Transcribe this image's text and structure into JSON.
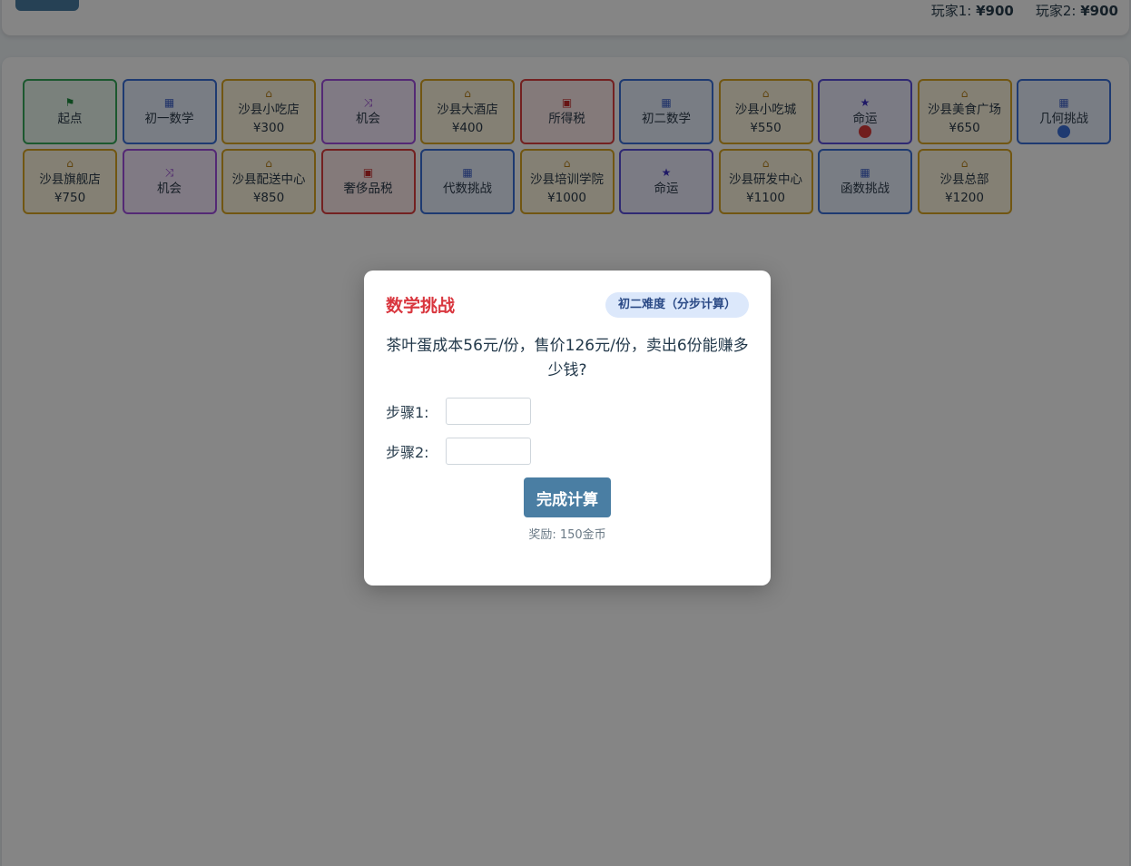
{
  "header": {
    "players": [
      {
        "label": "玩家1:",
        "money": "¥900"
      },
      {
        "label": "玩家2:",
        "money": "¥900"
      }
    ]
  },
  "board": {
    "cells": [
      {
        "type": "start",
        "icon": "flag-icon",
        "glyph": "⚑",
        "name": "起点",
        "price": ""
      },
      {
        "type": "math",
        "icon": "calculator-icon",
        "glyph": "▦",
        "name": "初一数学",
        "price": ""
      },
      {
        "type": "property",
        "icon": "house-icon",
        "glyph": "⌂",
        "name": "沙县小吃店",
        "price": "¥300"
      },
      {
        "type": "chance",
        "icon": "shuffle-icon",
        "glyph": "⤨",
        "name": "机会",
        "price": ""
      },
      {
        "type": "property",
        "icon": "house-icon",
        "glyph": "⌂",
        "name": "沙县大酒店",
        "price": "¥400"
      },
      {
        "type": "tax",
        "icon": "money-icon",
        "glyph": "▣",
        "name": "所得税",
        "price": ""
      },
      {
        "type": "math",
        "icon": "calculator-icon",
        "glyph": "▦",
        "name": "初二数学",
        "price": ""
      },
      {
        "type": "property",
        "icon": "house-icon",
        "glyph": "⌂",
        "name": "沙县小吃城",
        "price": "¥550"
      },
      {
        "type": "fate",
        "icon": "star-icon",
        "glyph": "★",
        "name": "命运",
        "price": "",
        "token": "player1"
      },
      {
        "type": "property",
        "icon": "house-icon",
        "glyph": "⌂",
        "name": "沙县美食广场",
        "price": "¥650"
      },
      {
        "type": "math",
        "icon": "calculator-icon",
        "glyph": "▦",
        "name": "几何挑战",
        "price": "",
        "token": "player2"
      },
      {
        "type": "property",
        "icon": "house-icon",
        "glyph": "⌂",
        "name": "沙县旗舰店",
        "price": "¥750"
      },
      {
        "type": "chance",
        "icon": "shuffle-icon",
        "glyph": "⤨",
        "name": "机会",
        "price": ""
      },
      {
        "type": "property",
        "icon": "house-icon",
        "glyph": "⌂",
        "name": "沙县配送中心",
        "price": "¥850"
      },
      {
        "type": "tax",
        "icon": "money-icon",
        "glyph": "▣",
        "name": "奢侈品税",
        "price": ""
      },
      {
        "type": "math",
        "icon": "calculator-icon",
        "glyph": "▦",
        "name": "代数挑战",
        "price": ""
      },
      {
        "type": "property",
        "icon": "house-icon",
        "glyph": "⌂",
        "name": "沙县培训学院",
        "price": "¥1000"
      },
      {
        "type": "fate",
        "icon": "star-icon",
        "glyph": "★",
        "name": "命运",
        "price": ""
      },
      {
        "type": "property",
        "icon": "house-icon",
        "glyph": "⌂",
        "name": "沙县研发中心",
        "price": "¥1100"
      },
      {
        "type": "math",
        "icon": "calculator-icon",
        "glyph": "▦",
        "name": "函数挑战",
        "price": ""
      },
      {
        "type": "property",
        "icon": "house-icon",
        "glyph": "⌂",
        "name": "沙县总部",
        "price": "¥1200"
      }
    ],
    "token_colors": {
      "player1": "#d93a3a",
      "player2": "#3b6fd8"
    }
  },
  "modal": {
    "title": "数学挑战",
    "difficulty": "初二难度（分步计算）",
    "question": "茶叶蛋成本56元/份，售价126元/份，卖出6份能赚多少钱?",
    "steps": [
      {
        "label": "步骤1:",
        "value": ""
      },
      {
        "label": "步骤2:",
        "value": ""
      }
    ],
    "submit_label": "完成计算",
    "reward": "奖励: 150金币"
  }
}
